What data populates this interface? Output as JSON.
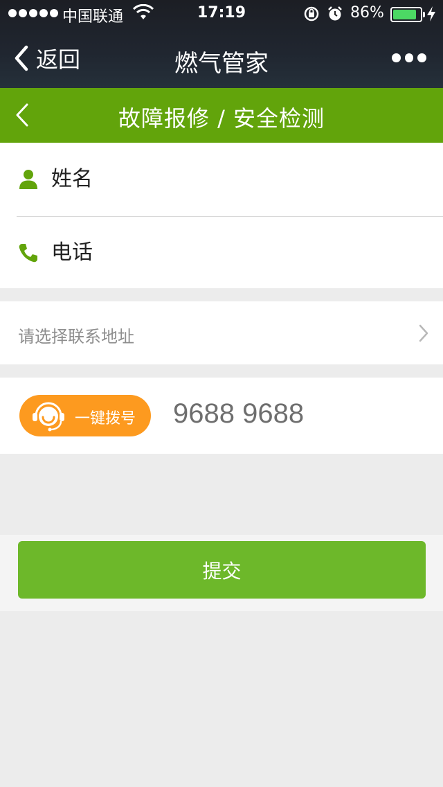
{
  "status_bar": {
    "carrier": "中国联通",
    "time": "17:19",
    "battery_percent": "86%",
    "battery_level": 0.86
  },
  "wechat_nav": {
    "back_label": "返回",
    "title": "燃气管家",
    "more_icon": "ellipsis-icon"
  },
  "page_header": {
    "title": "故障报修 / 安全检测",
    "back_icon": "chevron-left-icon"
  },
  "form": {
    "name_placeholder": "姓名",
    "name_icon": "person-icon",
    "phone_placeholder": "电话",
    "phone_icon": "phone-icon",
    "address_placeholder": "请选择联系地址"
  },
  "call": {
    "button_label": "一键拨号",
    "number": "9688 9688"
  },
  "submit_label": "提交",
  "colors": {
    "green_header": "#62a40b",
    "green_button": "#6db82a",
    "orange": "#fd9a1f",
    "icon_green": "#62a40b"
  }
}
